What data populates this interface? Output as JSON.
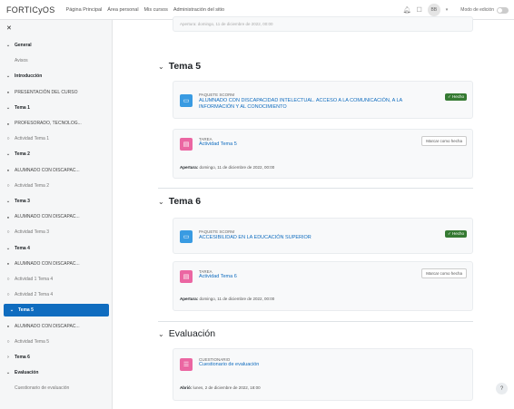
{
  "topbar": {
    "brand": "FORTICyOS",
    "nav": [
      "Página Principal",
      "Área personal",
      "Mis cursos",
      "Administración del sitio"
    ],
    "avatar": "BB",
    "edit_mode": "Modo de edición"
  },
  "sidebar": {
    "items": [
      {
        "label": "General",
        "type": "section",
        "icon": "chevron-down"
      },
      {
        "label": "Avisos",
        "type": "sub",
        "icon": ""
      },
      {
        "label": "Introducción",
        "type": "section",
        "icon": "chevron-down"
      },
      {
        "label": "PRESENTACIÓN DEL CURSO",
        "type": "activity",
        "icon": "dot"
      },
      {
        "label": "Tema 1",
        "type": "section",
        "icon": "chevron-down"
      },
      {
        "label": "PROFESORADO, TECNOLOG...",
        "type": "activity",
        "icon": "dot"
      },
      {
        "label": "Actividad Tema 1",
        "type": "sub",
        "icon": "circle"
      },
      {
        "label": "Tema 2",
        "type": "section",
        "icon": "chevron-down"
      },
      {
        "label": "ALUMNADO CON DISCAPAC...",
        "type": "activity",
        "icon": "dot"
      },
      {
        "label": "Actividad Tema 2",
        "type": "sub",
        "icon": "circle"
      },
      {
        "label": "Tema 3",
        "type": "section",
        "icon": "chevron-down"
      },
      {
        "label": "ALUMNADO CON DISCAPAC...",
        "type": "activity",
        "icon": "dot"
      },
      {
        "label": "Actividad Tema 3",
        "type": "sub",
        "icon": "circle"
      },
      {
        "label": "Tema 4",
        "type": "section",
        "icon": "chevron-down"
      },
      {
        "label": "ALUMNADO CON DISCAPAC...",
        "type": "activity",
        "icon": "dot"
      },
      {
        "label": "Actividad 1 Tema 4",
        "type": "sub",
        "icon": "circle"
      },
      {
        "label": "Actividad 2 Tema 4",
        "type": "sub",
        "icon": "circle"
      },
      {
        "label": "Tema 5",
        "type": "active",
        "icon": "chevron-down"
      },
      {
        "label": "ALUMNADO CON DISCAPAC...",
        "type": "activity",
        "icon": "dot"
      },
      {
        "label": "Actividad Tema 5",
        "type": "sub",
        "icon": "circle"
      },
      {
        "label": "Tema 6",
        "type": "section",
        "icon": "chevron-right"
      },
      {
        "label": "Evaluación",
        "type": "section",
        "icon": "chevron-down"
      },
      {
        "label": "Cuestionario de evaluación",
        "type": "sub",
        "icon": ""
      }
    ]
  },
  "main": {
    "top_card_text": "Apertura: domingo, 11 de diciembre de 2022, 00:00",
    "tema5": {
      "title": "Tema 5",
      "resource_type": "PAQUETE SCORM",
      "resource_title": "ALUMNADO CON DISCAPACIDAD INTELECTUAL. ACCESO A LA COMUNICACIÓN, A LA INFORMACIÓN Y AL CONOCIMIENTO",
      "done_badge": "✓ Hecho",
      "task_type": "TAREA",
      "task_title": "Actividad Tema 5",
      "mark_button": "Marcar como hecha",
      "opens_label": "Apertura:",
      "opens_value": "domingo, 11 de diciembre de 2022, 00:00"
    },
    "tema6": {
      "title": "Tema 6",
      "resource_type": "PAQUETE SCORM",
      "resource_title": "ACCESIBILIDAD EN LA EDUCACIÓN SUPERIOR",
      "done_badge": "✓ Hecho",
      "task_type": "TAREA",
      "task_title": "Actividad Tema 6",
      "mark_button": "Marcar como hecha",
      "opens_label": "Apertura:",
      "opens_value": "domingo, 11 de diciembre de 2022, 00:00"
    },
    "evaluacion": {
      "title": "Evaluación",
      "quiz_type": "CUESTIONARIO",
      "quiz_title": "Cuestionario de evaluación",
      "opens_label": "Abrió:",
      "opens_value": "lunes, 2 de diciembre de 2022, 18:00"
    }
  },
  "help_button": "?",
  "colors": {
    "accent": "#0f6cbf",
    "scorm": "#399be2",
    "task": "#eb66a2",
    "done": "#357a32"
  }
}
